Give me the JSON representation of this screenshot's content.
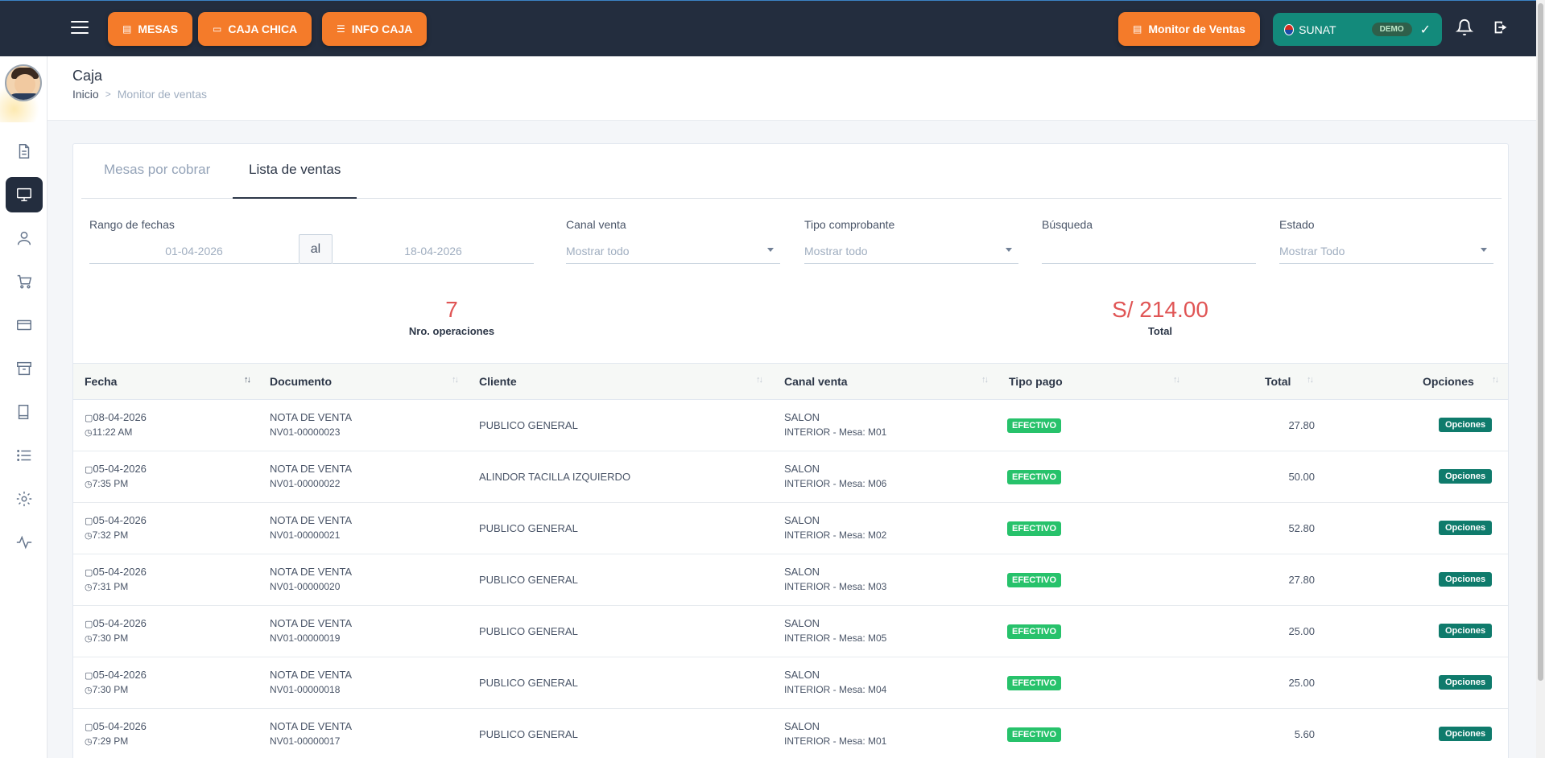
{
  "topbar": {
    "buttons": [
      {
        "label": "MESAS",
        "icon": "document-icon"
      },
      {
        "label": "CAJA CHICA",
        "icon": "monitor-icon"
      },
      {
        "label": "INFO CAJA",
        "icon": "list-icon"
      }
    ],
    "monitor_button": "Monitor de Ventas",
    "sunat": {
      "label": "SUNAT",
      "badge": "DEMO",
      "check": "✓"
    }
  },
  "page": {
    "title": "Caja",
    "breadcrumb": {
      "home": "Inicio",
      "separator": ">",
      "current": "Monitor de ventas"
    }
  },
  "tabs": [
    {
      "label": "Mesas por cobrar",
      "active": false
    },
    {
      "label": "Lista de ventas",
      "active": true
    }
  ],
  "filters": {
    "date_range": {
      "label": "Rango de fechas",
      "from": "01-04-2026",
      "sep": "al",
      "to": "18-04-2026"
    },
    "canal": {
      "label": "Canal venta",
      "value": "Mostrar todo"
    },
    "tipo": {
      "label": "Tipo comprobante",
      "value": "Mostrar todo"
    },
    "busqueda": {
      "label": "Búsqueda",
      "value": ""
    },
    "estado": {
      "label": "Estado",
      "value": "Mostrar Todo"
    }
  },
  "stats": {
    "operations": {
      "value": "7",
      "label": "Nro. operaciones"
    },
    "total": {
      "value": "S/ 214.00",
      "label": "Total"
    }
  },
  "table": {
    "headers": [
      "Fecha",
      "Documento",
      "Cliente",
      "Canal venta",
      "Tipo pago",
      "Total",
      "Opciones"
    ],
    "rows": [
      {
        "date": "08-04-2026",
        "time": "11:22 AM",
        "doc": "NOTA DE VENTA",
        "num": "NV01-00000023",
        "client": "PUBLICO GENERAL",
        "canal": "SALON",
        "mesa": "INTERIOR - Mesa: M01",
        "pago": "EFECTIVO",
        "total": "27.80",
        "opt": "Opciones"
      },
      {
        "date": "05-04-2026",
        "time": "7:35 PM",
        "doc": "NOTA DE VENTA",
        "num": "NV01-00000022",
        "client": "ALINDOR TACILLA IZQUIERDO",
        "canal": "SALON",
        "mesa": "INTERIOR - Mesa: M06",
        "pago": "EFECTIVO",
        "total": "50.00",
        "opt": "Opciones"
      },
      {
        "date": "05-04-2026",
        "time": "7:32 PM",
        "doc": "NOTA DE VENTA",
        "num": "NV01-00000021",
        "client": "PUBLICO GENERAL",
        "canal": "SALON",
        "mesa": "INTERIOR - Mesa: M02",
        "pago": "EFECTIVO",
        "total": "52.80",
        "opt": "Opciones"
      },
      {
        "date": "05-04-2026",
        "time": "7:31 PM",
        "doc": "NOTA DE VENTA",
        "num": "NV01-00000020",
        "client": "PUBLICO GENERAL",
        "canal": "SALON",
        "mesa": "INTERIOR - Mesa: M03",
        "pago": "EFECTIVO",
        "total": "27.80",
        "opt": "Opciones"
      },
      {
        "date": "05-04-2026",
        "time": "7:30 PM",
        "doc": "NOTA DE VENTA",
        "num": "NV01-00000019",
        "client": "PUBLICO GENERAL",
        "canal": "SALON",
        "mesa": "INTERIOR - Mesa: M05",
        "pago": "EFECTIVO",
        "total": "25.00",
        "opt": "Opciones"
      },
      {
        "date": "05-04-2026",
        "time": "7:30 PM",
        "doc": "NOTA DE VENTA",
        "num": "NV01-00000018",
        "client": "PUBLICO GENERAL",
        "canal": "SALON",
        "mesa": "INTERIOR - Mesa: M04",
        "pago": "EFECTIVO",
        "total": "25.00",
        "opt": "Opciones"
      },
      {
        "date": "05-04-2026",
        "time": "7:29 PM",
        "doc": "NOTA DE VENTA",
        "num": "NV01-00000017",
        "client": "PUBLICO GENERAL",
        "canal": "SALON",
        "mesa": "INTERIOR - Mesa: M01",
        "pago": "EFECTIVO",
        "total": "5.60",
        "opt": "Opciones"
      }
    ]
  },
  "sidebar": {
    "items": [
      "document-icon",
      "monitor-icon",
      "user-icon",
      "cart-icon",
      "card-icon",
      "archive-icon",
      "book-icon",
      "list-icon",
      "gear-icon",
      "activity-icon"
    ]
  },
  "colors": {
    "topbar": "#232d3e",
    "orange": "#f47b2a",
    "teal": "#138a7b",
    "red_stat": "#e05555",
    "green_badge": "#27c26b",
    "options_btn": "#0f7b6c"
  }
}
